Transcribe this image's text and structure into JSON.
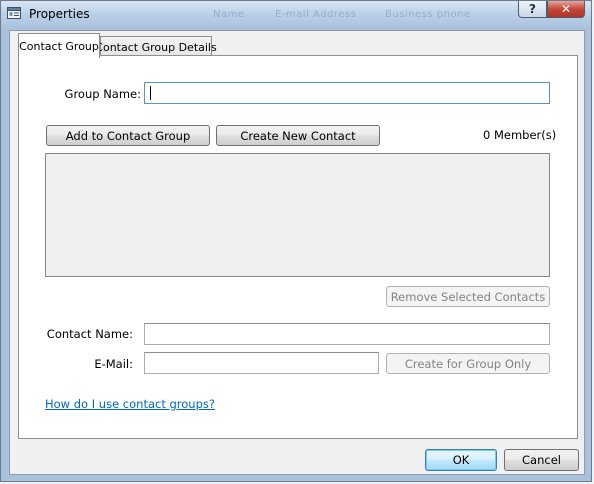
{
  "window": {
    "title": "Properties",
    "help_label": "?",
    "close_label": "✕",
    "ghost_titles": [
      "Name",
      "E-mail Address",
      "Business phone"
    ]
  },
  "tabs": [
    {
      "label": "Contact Group",
      "active": true
    },
    {
      "label": "Contact Group Details",
      "active": false
    }
  ],
  "form": {
    "group_name_label": "Group Name:",
    "group_name_value": "",
    "add_to_group_label": "Add to Contact Group",
    "create_new_contact_label": "Create New Contact",
    "member_count": "0 Member(s)",
    "members": [],
    "remove_selected_label": "Remove Selected Contacts",
    "contact_name_label": "Contact Name:",
    "contact_name_value": "",
    "email_label": "E-Mail:",
    "email_value": "",
    "create_for_group_label": "Create for Group Only",
    "help_link": "How do I use contact groups?"
  },
  "footer": {
    "ok_label": "OK",
    "cancel_label": "Cancel"
  }
}
